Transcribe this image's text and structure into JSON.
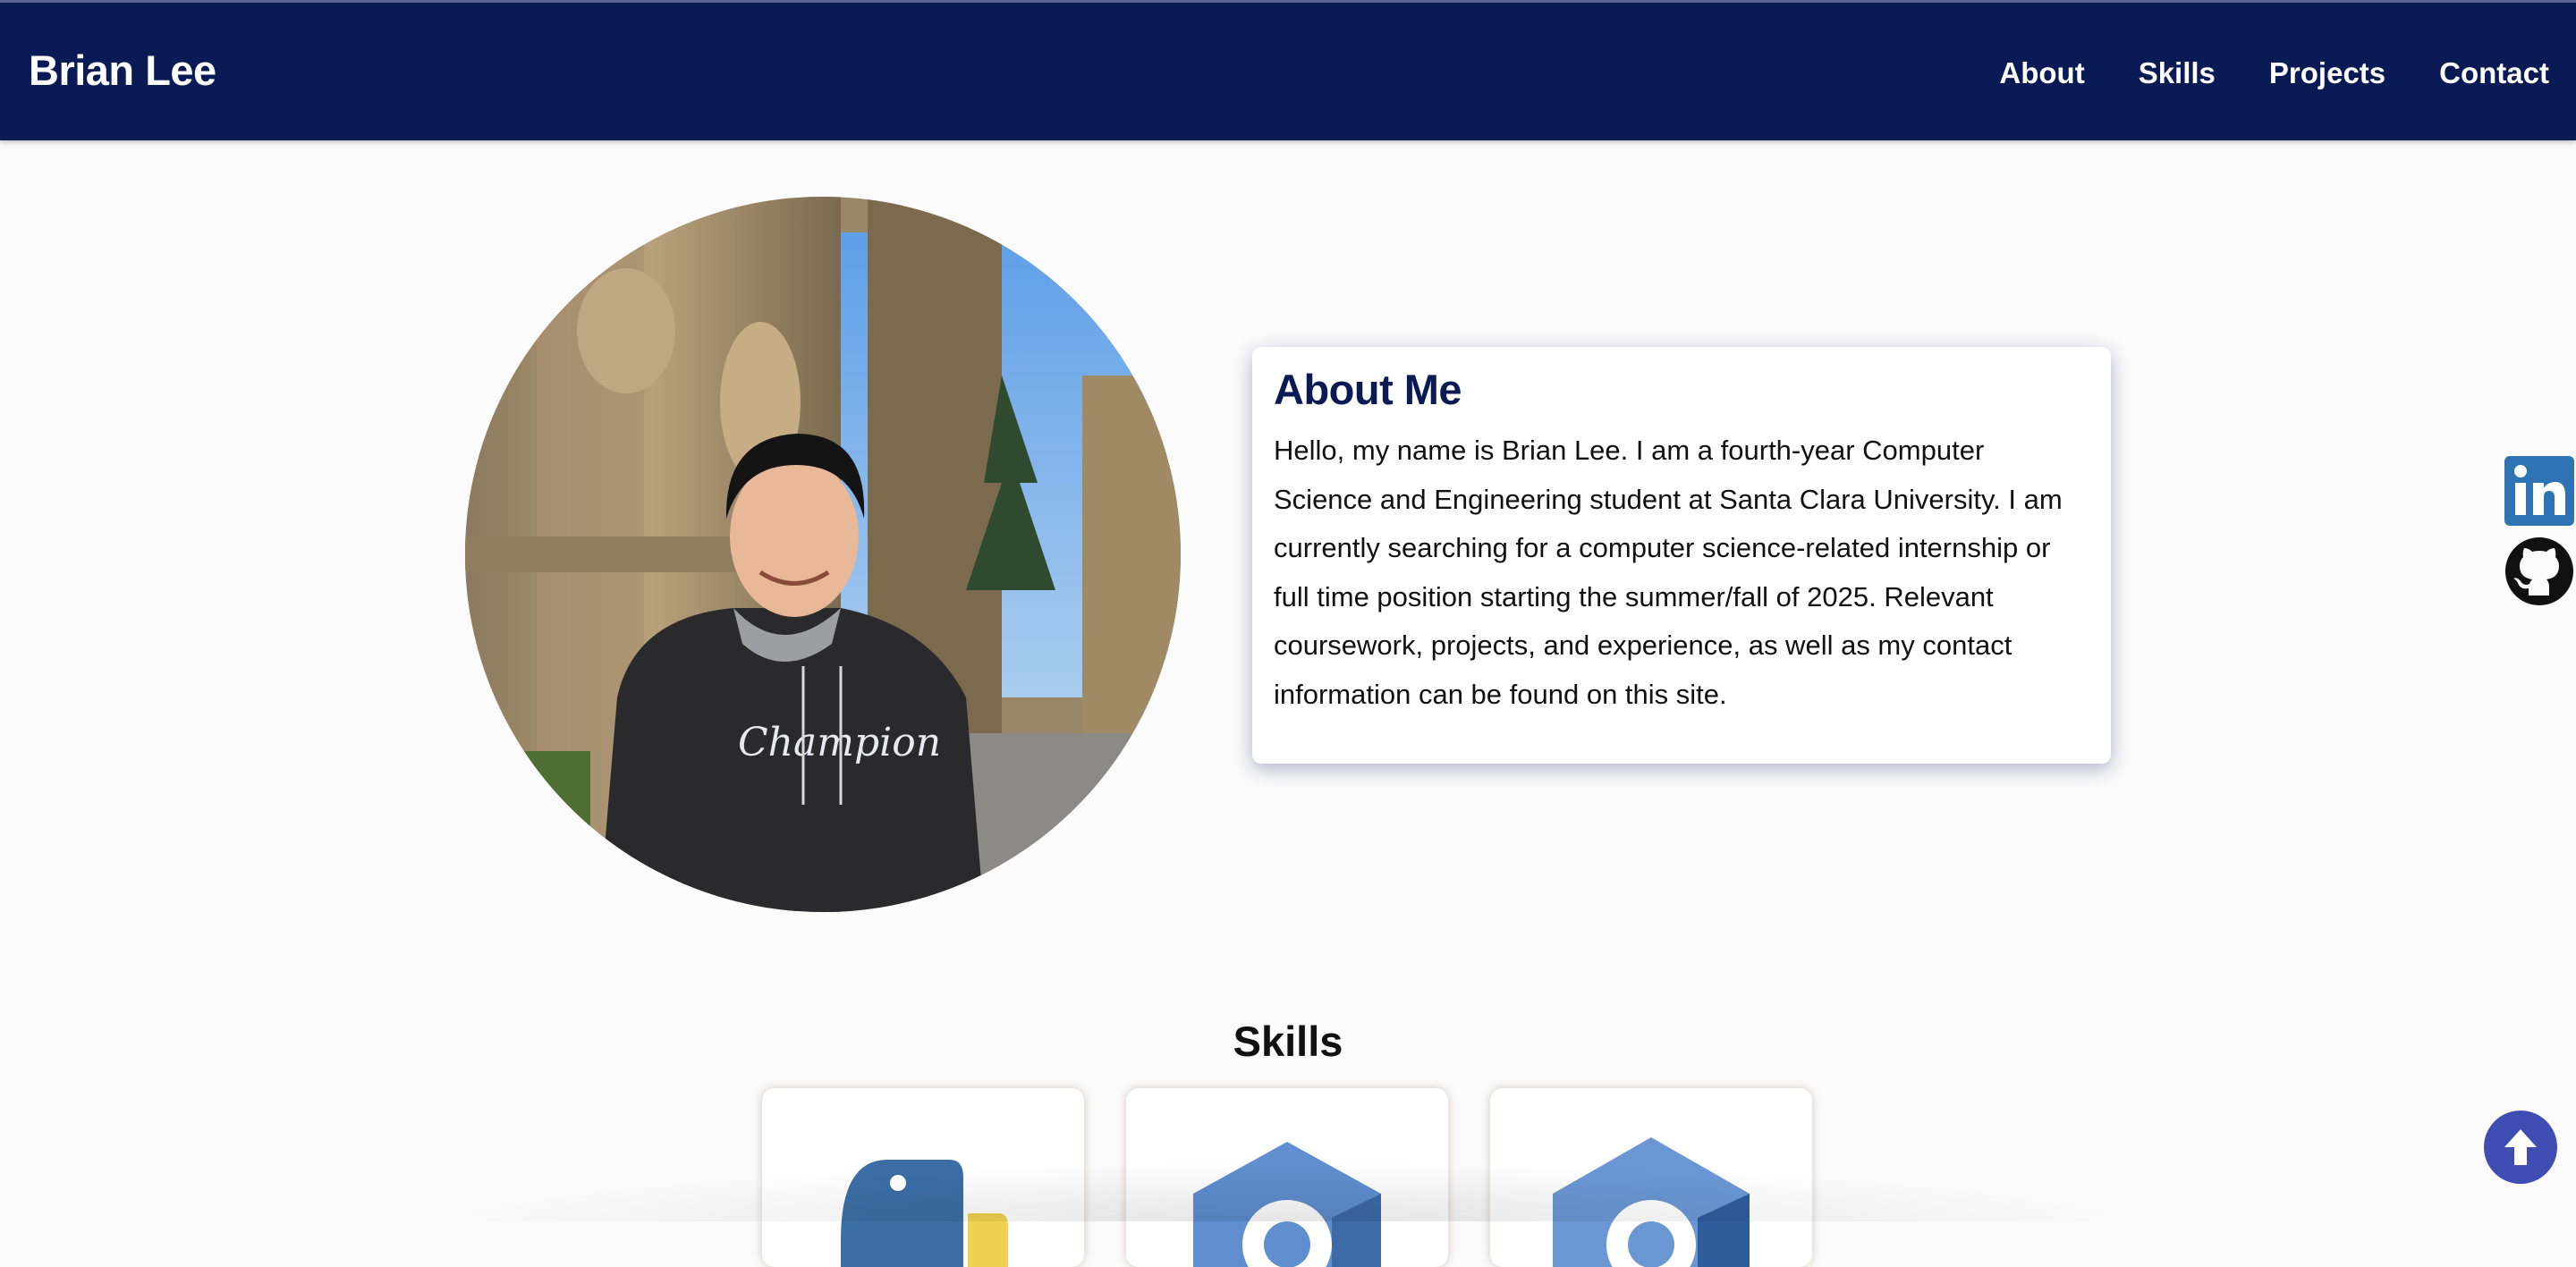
{
  "header": {
    "brand": "Brian Lee",
    "nav": [
      "About",
      "Skills",
      "Projects",
      "Contact"
    ]
  },
  "about": {
    "heading": "About Me",
    "body": "Hello, my name is Brian Lee. I am a fourth-year Computer Science and Engineering student at Santa Clara University. I am currently searching for a computer science-related internship or full time position starting the summer/fall of 2025. Relevant coursework, projects, and experience, as well as my contact information can be found on this site.",
    "photo_text": "Champion"
  },
  "skills": {
    "heading": "Skills",
    "cards": [
      {
        "icon": "python-icon"
      },
      {
        "icon": "c-language-icon"
      },
      {
        "icon": "cpp-language-icon"
      }
    ]
  },
  "social": {
    "linkedin": "linkedin-icon",
    "github": "github-icon"
  },
  "colors": {
    "navbar": "#091a55",
    "accent": "#3f4db3",
    "heading": "#0b1a55"
  }
}
